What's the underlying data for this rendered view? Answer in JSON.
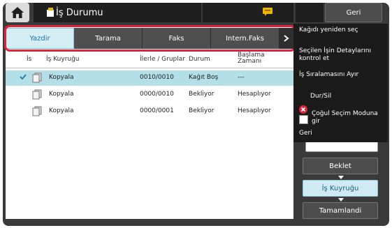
{
  "header": {
    "title": "İş Durumu",
    "back_label": "Geri"
  },
  "tabs": [
    {
      "label": "Yazdir",
      "active": true
    },
    {
      "label": "Tarama",
      "active": false
    },
    {
      "label": "Faks",
      "active": false
    },
    {
      "label": "Intern.Faks",
      "active": false
    }
  ],
  "table": {
    "columns": [
      "İs",
      "İş Kuyruğu",
      "İlerle / Gruplar",
      "Durum",
      "Başlama Zamanı"
    ],
    "rows": [
      {
        "queue": "Kopyala",
        "progress": "0010/0010",
        "status": "Kağıt Boş",
        "start": "---",
        "selected": true
      },
      {
        "queue": "Kopyala",
        "progress": "0000/0010",
        "status": "Bekliyor",
        "start": "Hesaplıyor",
        "selected": false
      },
      {
        "queue": "Kopyala",
        "progress": "0000/0001",
        "status": "Bekliyor",
        "start": "Hesaplıyor",
        "selected": false
      }
    ]
  },
  "side_menu": {
    "items": [
      "Kağıdı yeniden seç",
      "Seçilen İşin Detaylarını kontrol et",
      "İş Sıralamasını Ayır",
      "Dur/Sil",
      "Çoğul Seçim Moduna gir",
      "Geri"
    ]
  },
  "panel": {
    "beklet": "Beklet",
    "is_kuyrugu": "İş Kuyruğu",
    "tamamlandi": "Tamamlandi"
  },
  "icons": {
    "home": "home-icon",
    "printer": "printer-icon",
    "message": "message-icon",
    "document": "document-stack-icon",
    "check": "check-icon",
    "stop": "stop-icon"
  },
  "colors": {
    "highlight_frame": "#e0233a",
    "active_tab": "#d4eef3",
    "selected_row": "#b5dfe8",
    "stop_red": "#e0233a"
  }
}
